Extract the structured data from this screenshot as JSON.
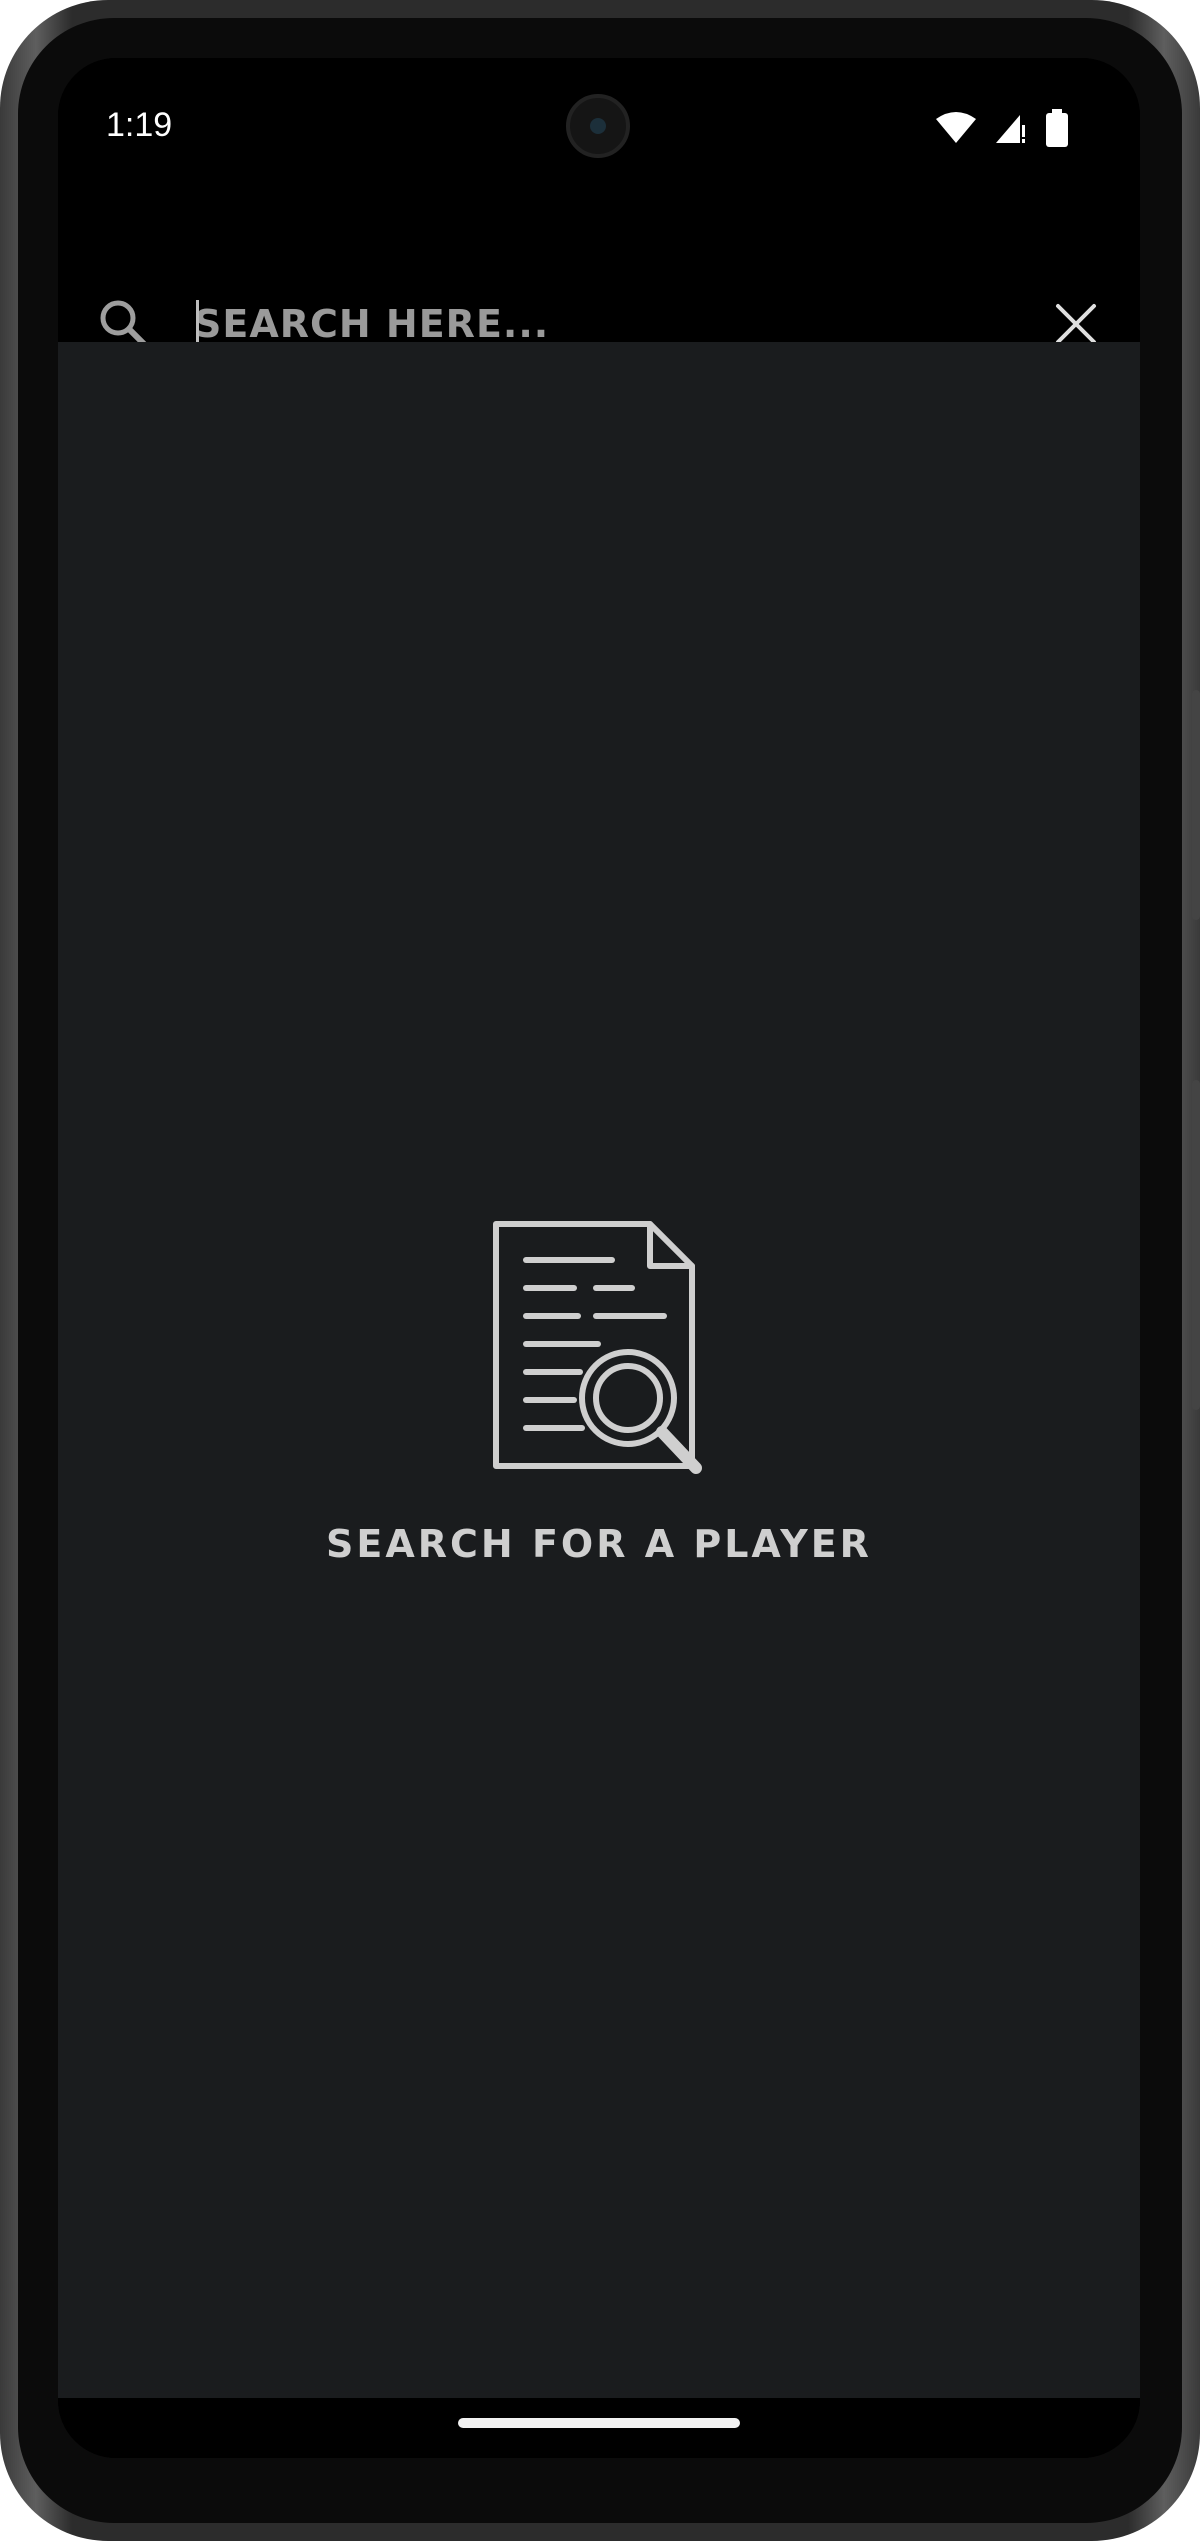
{
  "status_bar": {
    "time": "1:19",
    "icons": [
      "wifi-icon",
      "cellular-signal-icon",
      "battery-icon"
    ]
  },
  "search": {
    "placeholder": "SEARCH HERE...",
    "value": "",
    "search_icon": "search-icon",
    "clear_icon": "close-icon"
  },
  "empty_state": {
    "icon": "document-search-icon",
    "message": "SEARCH FOR A PLAYER"
  },
  "colors": {
    "accent": "#4a0fa0",
    "background": "#1a1c1e",
    "toolbar": "#000000",
    "text_muted": "#cfcfcf"
  }
}
